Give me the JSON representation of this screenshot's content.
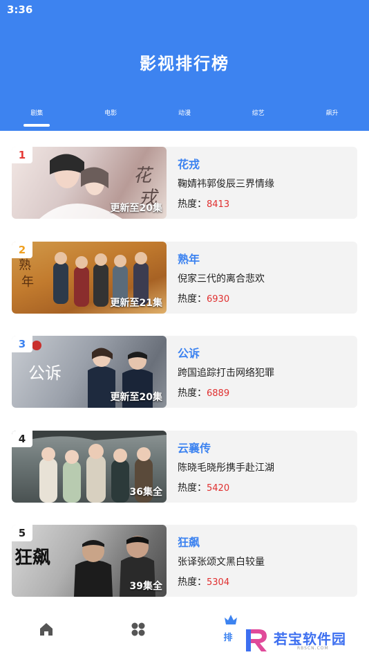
{
  "status_bar": {
    "time": "3:36"
  },
  "header": {
    "title": "影视排行榜"
  },
  "tabs": [
    {
      "label": "剧集",
      "active": true
    },
    {
      "label": "电影",
      "active": false
    },
    {
      "label": "动漫",
      "active": false
    },
    {
      "label": "综艺",
      "active": false
    },
    {
      "label": "飙升",
      "active": false
    }
  ],
  "heat_label": "热度：",
  "items": [
    {
      "rank": "1",
      "rank_color": "#e53935",
      "title": "花戎",
      "desc": "鞠婧祎郭俊辰三界情缘",
      "heat": "8413",
      "episodes": "更新至20集"
    },
    {
      "rank": "2",
      "rank_color": "#f0a020",
      "title": "熟年",
      "desc": "倪家三代的离合悲欢",
      "heat": "6930",
      "episodes": "更新至21集"
    },
    {
      "rank": "3",
      "rank_color": "#3d83f0",
      "title": "公诉",
      "desc": "跨国追踪打击网络犯罪",
      "heat": "6889",
      "episodes": "更新至20集"
    },
    {
      "rank": "4",
      "rank_color": "#222222",
      "title": "云襄传",
      "desc": "陈晓毛晓彤携手赴江湖",
      "heat": "5420",
      "episodes": "36集全"
    },
    {
      "rank": "5",
      "rank_color": "#222222",
      "title": "狂飙",
      "desc": "张译张颂文黑白较量",
      "heat": "5304",
      "episodes": "39集全"
    }
  ],
  "bottom_nav": {
    "home_icon": "home-icon",
    "category_icon": "grid-icon",
    "rank_icon": "crown-icon",
    "rank_label": "排"
  },
  "watermark": {
    "text": "若宝软件园",
    "sub": "RBSCN.COM"
  }
}
